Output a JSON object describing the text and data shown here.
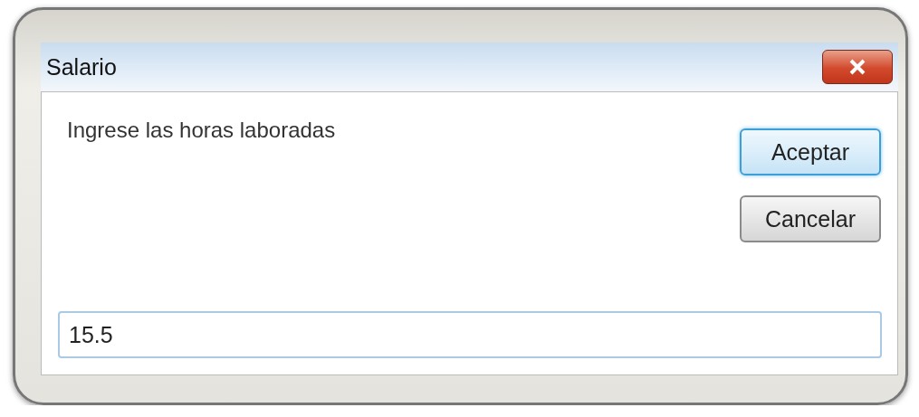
{
  "window": {
    "title": "Salario"
  },
  "prompt": "Ingrese las horas laboradas",
  "buttons": [
    {
      "label": "Aceptar",
      "default": true
    },
    {
      "label": "Cancelar",
      "default": false
    }
  ],
  "input": {
    "value": "15.5"
  }
}
